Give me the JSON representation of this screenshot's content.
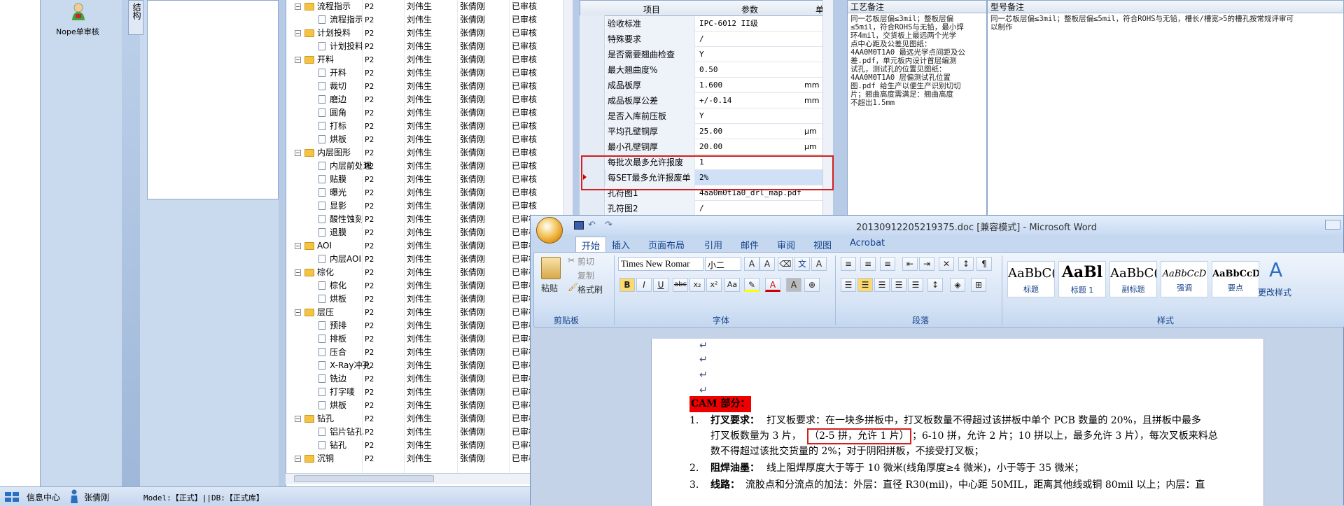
{
  "nav": {
    "nope_label": "Nope单审核",
    "struct_tab": "结构"
  },
  "tree": {
    "rows": [
      {
        "indent": 1,
        "kind": "folder",
        "name": "流程指示",
        "p": "P2",
        "a": "刘伟生",
        "b": "张倩刚",
        "s": "已审核"
      },
      {
        "indent": 2,
        "kind": "doc",
        "name": "流程指示",
        "p": "P2",
        "a": "刘伟生",
        "b": "张倩刚",
        "s": "已审核"
      },
      {
        "indent": 1,
        "kind": "folder",
        "name": "计划投料",
        "p": "P2",
        "a": "刘伟生",
        "b": "张倩刚",
        "s": "已审核"
      },
      {
        "indent": 2,
        "kind": "doc",
        "name": "计划投料",
        "p": "P2",
        "a": "刘伟生",
        "b": "张倩刚",
        "s": "已审核"
      },
      {
        "indent": 1,
        "kind": "folder",
        "name": "开料",
        "p": "P2",
        "a": "刘伟生",
        "b": "张倩刚",
        "s": "已审核"
      },
      {
        "indent": 2,
        "kind": "doc",
        "name": "开料",
        "p": "P2",
        "a": "刘伟生",
        "b": "张倩刚",
        "s": "已审核"
      },
      {
        "indent": 2,
        "kind": "doc",
        "name": "裁切",
        "p": "P2",
        "a": "刘伟生",
        "b": "张倩刚",
        "s": "已审核"
      },
      {
        "indent": 2,
        "kind": "doc",
        "name": "磨边",
        "p": "P2",
        "a": "刘伟生",
        "b": "张倩刚",
        "s": "已审核"
      },
      {
        "indent": 2,
        "kind": "doc",
        "name": "圆角",
        "p": "P2",
        "a": "刘伟生",
        "b": "张倩刚",
        "s": "已审核"
      },
      {
        "indent": 2,
        "kind": "doc",
        "name": "打标",
        "p": "P2",
        "a": "刘伟生",
        "b": "张倩刚",
        "s": "已审核"
      },
      {
        "indent": 2,
        "kind": "doc",
        "name": "烘板",
        "p": "P2",
        "a": "刘伟生",
        "b": "张倩刚",
        "s": "已审核"
      },
      {
        "indent": 1,
        "kind": "folder",
        "name": "内层图形",
        "p": "P2",
        "a": "刘伟生",
        "b": "张倩刚",
        "s": "已审核"
      },
      {
        "indent": 2,
        "kind": "doc",
        "name": "内层前处理",
        "p": "P2",
        "a": "刘伟生",
        "b": "张倩刚",
        "s": "已审核"
      },
      {
        "indent": 2,
        "kind": "doc",
        "name": "贴膜",
        "p": "P2",
        "a": "刘伟生",
        "b": "张倩刚",
        "s": "已审核"
      },
      {
        "indent": 2,
        "kind": "doc",
        "name": "曝光",
        "p": "P2",
        "a": "刘伟生",
        "b": "张倩刚",
        "s": "已审核"
      },
      {
        "indent": 2,
        "kind": "doc",
        "name": "显影",
        "p": "P2",
        "a": "刘伟生",
        "b": "张倩刚",
        "s": "已审核"
      },
      {
        "indent": 2,
        "kind": "doc",
        "name": "酸性蚀刻",
        "p": "P2",
        "a": "刘伟生",
        "b": "张倩刚",
        "s": "已审核"
      },
      {
        "indent": 2,
        "kind": "doc",
        "name": "退膜",
        "p": "P2",
        "a": "刘伟生",
        "b": "张倩刚",
        "s": "已审核"
      },
      {
        "indent": 1,
        "kind": "folder",
        "name": "AOI",
        "p": "P2",
        "a": "刘伟生",
        "b": "张倩刚",
        "s": "已审核"
      },
      {
        "indent": 2,
        "kind": "doc",
        "name": "内层AOI",
        "p": "P2",
        "a": "刘伟生",
        "b": "张倩刚",
        "s": "已审核"
      },
      {
        "indent": 1,
        "kind": "folder",
        "name": "棕化",
        "p": "P2",
        "a": "刘伟生",
        "b": "张倩刚",
        "s": "已审核"
      },
      {
        "indent": 2,
        "kind": "doc",
        "name": "棕化",
        "p": "P2",
        "a": "刘伟生",
        "b": "张倩刚",
        "s": "已审核"
      },
      {
        "indent": 2,
        "kind": "doc",
        "name": "烘板",
        "p": "P2",
        "a": "刘伟生",
        "b": "张倩刚",
        "s": "已审核"
      },
      {
        "indent": 1,
        "kind": "folder",
        "name": "层压",
        "p": "P2",
        "a": "刘伟生",
        "b": "张倩刚",
        "s": "已审核"
      },
      {
        "indent": 2,
        "kind": "doc",
        "name": "预排",
        "p": "P2",
        "a": "刘伟生",
        "b": "张倩刚",
        "s": "已审核"
      },
      {
        "indent": 2,
        "kind": "doc",
        "name": "排板",
        "p": "P2",
        "a": "刘伟生",
        "b": "张倩刚",
        "s": "已审核"
      },
      {
        "indent": 2,
        "kind": "doc",
        "name": "压合",
        "p": "P2",
        "a": "刘伟生",
        "b": "张倩刚",
        "s": "已审核"
      },
      {
        "indent": 2,
        "kind": "doc",
        "name": "X-Ray冲孔",
        "p": "P2",
        "a": "刘伟生",
        "b": "张倩刚",
        "s": "已审核"
      },
      {
        "indent": 2,
        "kind": "doc",
        "name": "铣边",
        "p": "P2",
        "a": "刘伟生",
        "b": "张倩刚",
        "s": "已审核"
      },
      {
        "indent": 2,
        "kind": "doc",
        "name": "打字唛",
        "p": "P2",
        "a": "刘伟生",
        "b": "张倩刚",
        "s": "已审核"
      },
      {
        "indent": 2,
        "kind": "doc",
        "name": "烘板",
        "p": "P2",
        "a": "刘伟生",
        "b": "张倩刚",
        "s": "已审核"
      },
      {
        "indent": 1,
        "kind": "folder",
        "name": "钻孔",
        "p": "P2",
        "a": "刘伟生",
        "b": "张倩刚",
        "s": "已审核"
      },
      {
        "indent": 2,
        "kind": "doc",
        "name": "铝片钻孔",
        "p": "P2",
        "a": "刘伟生",
        "b": "张倩刚",
        "s": "已审核"
      },
      {
        "indent": 2,
        "kind": "doc",
        "name": "钻孔",
        "p": "P2",
        "a": "刘伟生",
        "b": "张倩刚",
        "s": "已审核"
      },
      {
        "indent": 1,
        "kind": "folder",
        "name": "沉铜",
        "p": "P2",
        "a": "刘伟生",
        "b": "张倩刚",
        "s": "已审核"
      }
    ]
  },
  "grid": {
    "headers": {
      "item": "项目",
      "param": "参数",
      "unit": "单位"
    },
    "rows": [
      {
        "item": "验收标准",
        "param": "IPC-6012 II级",
        "unit": ""
      },
      {
        "item": "特殊要求",
        "param": "/",
        "unit": ""
      },
      {
        "item": "是否需要翘曲检查",
        "param": "Y",
        "unit": ""
      },
      {
        "item": "最大翘曲度%",
        "param": "0.50",
        "unit": ""
      },
      {
        "item": "成品板厚",
        "param": "1.600",
        "unit": "mm"
      },
      {
        "item": "成品板厚公差",
        "param": "+/-0.14",
        "unit": "mm"
      },
      {
        "item": "是否入库前压板",
        "param": "Y",
        "unit": ""
      },
      {
        "item": "平均孔壁铜厚",
        "param": "25.00",
        "unit": "μm"
      },
      {
        "item": "最小孔壁铜厚",
        "param": "20.00",
        "unit": "μm"
      },
      {
        "item": "每批次最多允许报废SET",
        "param": "1",
        "unit": ""
      },
      {
        "item": "每SET最多允许报废单元",
        "param": "2%",
        "unit": ""
      },
      {
        "item": "孔符图1",
        "param": "4aa0m0t1a0_drl_map.pdf",
        "unit": ""
      },
      {
        "item": "孔符图2",
        "param": "/",
        "unit": ""
      }
    ]
  },
  "notes": {
    "process_head": "工艺备注",
    "process_text": "同一芯板层偏≤3mil；整板层偏\n≤5mil，符合ROHS与无铅，最小焊\n环4mil，交货板上最远两个光学\n点中心距及公差见图纸：\n4AA0M0T1A0 最远光学点间距及公\n差.pdf，单元板内设计首层编测\n试孔，测试孔的位置见图纸：\n4AA0M0T1A0 层偏测试孔位置\n图.pdf 给生产以便生产识别切切\n片；翘曲高度需满足：翘曲高度\n不超出1.5mm",
    "model_head": "型号备注",
    "model_text": "同一芯板层偏≤3mil；整板层偏≤5mil，符合ROHS与无铅，槽长/槽宽>5的槽孔按常规评审可\n以制作"
  },
  "status": {
    "info_center": "信息中心",
    "user": "张倩刚",
    "model_db": "Model:【正式】||DB:【正式库】"
  },
  "word": {
    "title": "20130912205219375.doc [兼容模式] - Microsoft Word",
    "tabs": [
      "开始",
      "插入",
      "页面布局",
      "引用",
      "邮件",
      "审阅",
      "视图",
      "Acrobat"
    ],
    "clipboard": {
      "paste": "粘贴",
      "cut": "剪切",
      "copy": "复制",
      "format_painter": "格式刷",
      "label": "剪贴板"
    },
    "font": {
      "name": "Times New Romar",
      "size": "小二",
      "label": "字体"
    },
    "paragraph_label": "段落",
    "styles": [
      {
        "sample": "AaBbC(",
        "name": "标题"
      },
      {
        "sample": "AaBl",
        "name": "标题 1"
      },
      {
        "sample": "AaBbC(",
        "name": "副标题"
      },
      {
        "sample": "AaBbCcD",
        "name": "强调"
      },
      {
        "sample": "AaBbCcD",
        "name": "要点"
      }
    ],
    "change_styles": "更改样式",
    "styles_label": "样式",
    "doc": {
      "cam_heading": "CAM 部分：",
      "l1_num": "1.",
      "l1_bold": "打叉要求：",
      "l1_text": "打叉板要求：在一块多拼板中，打叉板数量不得超过该拼板中单个 PCB 数量的 20%，且拼板中最多",
      "l1b_pre": "打叉板数量为 3 片，",
      "l1b_box": "（2-5 拼，允许 1 片）",
      "l1b_post": "；6-10 拼，允许 2 片；10 拼以上，最多允许 3 片），每次叉板来料总",
      "l1c": "数不得超过该批交货量的 2%；对于阴阳拼板，不接受打叉板；",
      "l2_num": "2.",
      "l2_bold": "阻焊油墨：",
      "l2_text": "线上阻焊厚度大于等于 10 微米(线角厚度≥4 微米)，小于等于 35 微米；",
      "l3_num": "3.",
      "l3_bold": "线路：",
      "l3_text": "流胶点和分流点的加法：外层：直径 R30(mil)，中心距 50MIL，距离其他线或铜 80mil 以上；内层：直"
    }
  }
}
